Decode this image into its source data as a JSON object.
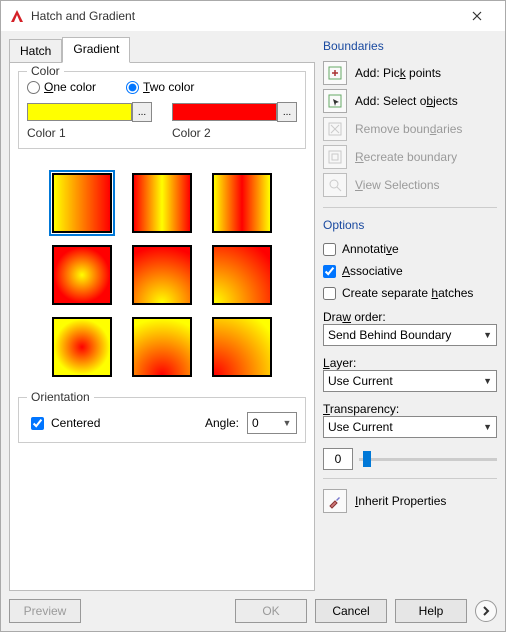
{
  "window": {
    "title": "Hatch and Gradient"
  },
  "tabs": {
    "hatch": "Hatch",
    "gradient": "Gradient",
    "active": "gradient"
  },
  "color_group": {
    "legend": "Color",
    "one": "ne color",
    "one_prefix": "O",
    "two": "wo color",
    "two_prefix": "T",
    "selected": "two",
    "color1_label": "Color 1",
    "color2_label": "Color 2",
    "color1_value": "#ffff00",
    "color2_value": "#ff0000",
    "ellipsis": "..."
  },
  "orientation": {
    "legend": "Orientation",
    "centered_prefix": "C",
    "centered": "entered",
    "centered_checked": true,
    "angle_label": "Angle:",
    "angle_value": "0"
  },
  "boundaries": {
    "legend": "Boundaries",
    "add_pick": {
      "prefix": "Add: Pic",
      "ul": "k",
      "suffix": " points"
    },
    "add_select": {
      "prefix": "Add: Select o",
      "ul": "b",
      "suffix": "jects"
    },
    "remove": {
      "prefix": "Remove boun",
      "ul": "d",
      "suffix": "aries"
    },
    "recreate": {
      "ul": "R",
      "suffix": "ecreate boundary"
    },
    "view": {
      "ul": "V",
      "suffix": "iew Selections"
    }
  },
  "options": {
    "legend": "Options",
    "annotative": {
      "label": "Annotati",
      "ul": "v",
      "suffix": "e",
      "checked": false
    },
    "associative": {
      "ul": "A",
      "suffix": "ssociative",
      "checked": true
    },
    "create_sep": {
      "label": "Create separate ",
      "ul": "h",
      "suffix": "atches",
      "checked": false
    },
    "draw_order": {
      "label_prefix": "Dra",
      "label_ul": "w",
      "label_suffix": " order:",
      "value": "Send Behind Boundary"
    },
    "layer": {
      "label_ul": "L",
      "label_suffix": "ayer:",
      "value": "Use Current"
    },
    "transparency": {
      "label_ul": "T",
      "label_suffix": "ransparency:",
      "value": "Use Current",
      "num": "0"
    }
  },
  "inherit": {
    "ul": "I",
    "suffix": "nherit Properties"
  },
  "footer": {
    "preview": "Preview",
    "ok": "OK",
    "cancel": "Cancel",
    "help": "Help"
  }
}
